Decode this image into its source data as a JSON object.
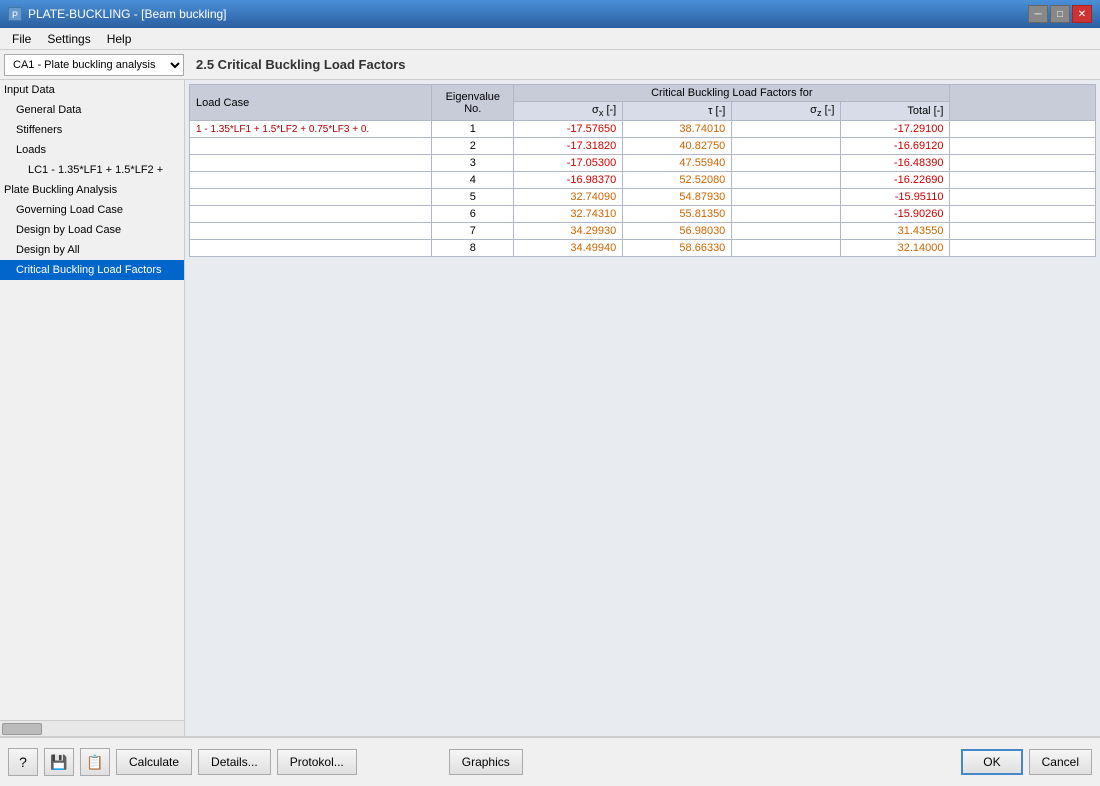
{
  "window": {
    "title": "PLATE-BUCKLING - [Beam buckling]",
    "close_btn": "✕",
    "min_btn": "─",
    "max_btn": "□"
  },
  "menu": {
    "items": [
      "File",
      "Settings",
      "Help"
    ]
  },
  "top_bar": {
    "dropdown_value": "CA1 - Plate buckling analysis",
    "dropdown_options": [
      "CA1 - Plate buckling analysis"
    ],
    "section_title": "2.5 Critical Buckling Load Factors"
  },
  "sidebar": {
    "items": [
      {
        "label": "Input Data",
        "level": 0,
        "selected": false
      },
      {
        "label": "General Data",
        "level": 1,
        "selected": false
      },
      {
        "label": "Stiffeners",
        "level": 1,
        "selected": false
      },
      {
        "label": "Loads",
        "level": 1,
        "selected": false
      },
      {
        "label": "LC1 - 1.35*LF1 + 1.5*LF2 +",
        "level": 2,
        "selected": false
      },
      {
        "label": "Plate Buckling Analysis",
        "level": 0,
        "selected": false
      },
      {
        "label": "Governing Load Case",
        "level": 1,
        "selected": false
      },
      {
        "label": "Design by Load Case",
        "level": 1,
        "selected": false
      },
      {
        "label": "Design by All",
        "level": 1,
        "selected": false
      },
      {
        "label": "Critical Buckling Load Factors",
        "level": 1,
        "selected": true
      }
    ]
  },
  "table": {
    "header_row1": [
      "Load Case",
      "Eigenvalue",
      "Critical Buckling Load Factors for",
      "",
      "",
      ""
    ],
    "header_row2": [
      "",
      "No.",
      "σx [-]",
      "τ [-]",
      "σz [-]",
      "Total [-]",
      ""
    ],
    "rows": [
      {
        "load_case": "1 - 1.35*LF1 + 1.5*LF2 + 0.75*LF3 + 0.",
        "no": 1,
        "sigma_x": "-17.57650",
        "tau": "38.74010",
        "sigma_z": "",
        "total": "-17.29100",
        "highlight": "negative"
      },
      {
        "load_case": "",
        "no": 2,
        "sigma_x": "-17.31820",
        "tau": "40.82750",
        "sigma_z": "",
        "total": "-16.69120",
        "highlight": "negative"
      },
      {
        "load_case": "",
        "no": 3,
        "sigma_x": "-17.05300",
        "tau": "47.55940",
        "sigma_z": "",
        "total": "-16.48390",
        "highlight": "negative"
      },
      {
        "load_case": "",
        "no": 4,
        "sigma_x": "-16.98370",
        "tau": "52.52080",
        "sigma_z": "",
        "total": "-16.22690",
        "highlight": "negative"
      },
      {
        "load_case": "",
        "no": 5,
        "sigma_x": "32.74090",
        "tau": "54.87930",
        "sigma_z": "",
        "total": "-15.95110",
        "highlight": "mixed"
      },
      {
        "load_case": "",
        "no": 6,
        "sigma_x": "32.74310",
        "tau": "55.81350",
        "sigma_z": "",
        "total": "-15.90260",
        "highlight": "mixed"
      },
      {
        "load_case": "",
        "no": 7,
        "sigma_x": "34.29930",
        "tau": "56.98030",
        "sigma_z": "",
        "total": "31.43550",
        "highlight": "positive"
      },
      {
        "load_case": "",
        "no": 8,
        "sigma_x": "34.49940",
        "tau": "58.66330",
        "sigma_z": "",
        "total": "32.14000",
        "highlight": "positive"
      }
    ]
  },
  "buttons": {
    "calculate": "Calculate",
    "details": "Details...",
    "protokol": "Protokol...",
    "graphics": "Graphics",
    "ok": "OK",
    "cancel": "Cancel"
  },
  "icons": {
    "help": "?",
    "save": "💾",
    "copy": "📋"
  }
}
